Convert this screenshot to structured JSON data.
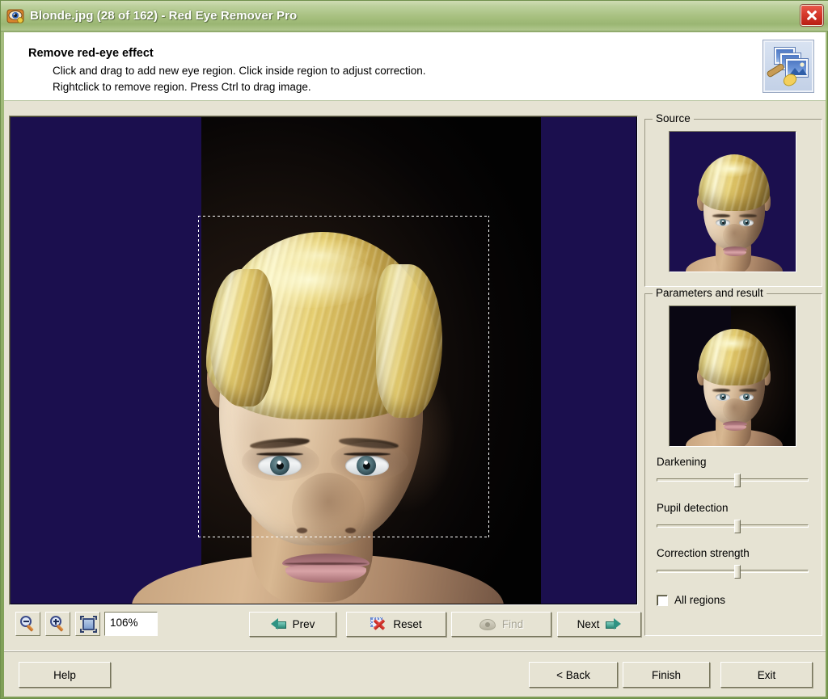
{
  "window": {
    "title": "Blonde.jpg (28 of 162) - Red Eye Remover Pro",
    "app_icon": "red-eye-app-icon",
    "close_icon": "close-icon",
    "titlebar_color": "#a6bf7e",
    "face_color": "#e6e3d3"
  },
  "header": {
    "title": "Remove red-eye effect",
    "line1": "Click and drag to add new eye region. Click inside region to adjust correction.",
    "line2": "Rightclick to remove region. Press Ctrl to drag image.",
    "icon": "photo-stack-brush-icon"
  },
  "toolbar": {
    "zoom_out_icon": "zoom-out-icon",
    "zoom_in_icon": "zoom-in-icon",
    "fit_icon": "fit-to-window-icon",
    "zoom_value": "106%",
    "prev_label": "Prev",
    "prev_icon": "arrow-left-icon",
    "reset_label": "Reset",
    "reset_icon": "reset-region-icon",
    "find_label": "Find",
    "find_icon": "eye-find-icon",
    "find_enabled": false,
    "next_label": "Next",
    "next_icon": "arrow-right-icon"
  },
  "panels": {
    "source_label": "Source",
    "result_label": "Parameters and result"
  },
  "sliders": [
    {
      "label": "Darkening",
      "value": 53
    },
    {
      "label": "Pupil detection",
      "value": 53
    },
    {
      "label": "Correction strength",
      "value": 53
    }
  ],
  "checkbox": {
    "label": "All regions",
    "checked": false
  },
  "footer": {
    "help_label": "Help",
    "back_label": "< Back",
    "finish_label": "Finish",
    "exit_label": "Exit"
  }
}
